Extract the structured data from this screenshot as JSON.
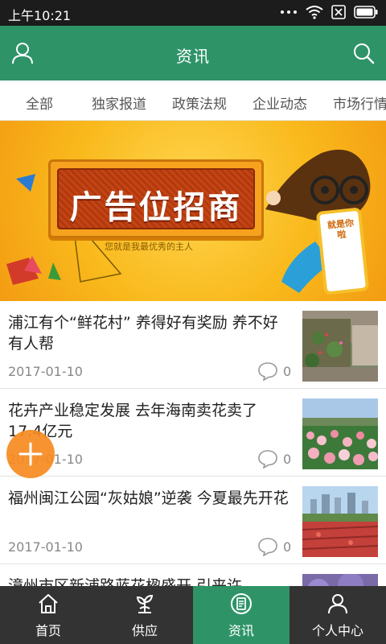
{
  "status_bar": {
    "time": "上午10:21"
  },
  "header": {
    "title": "资讯"
  },
  "tabs": [
    {
      "label": "全部"
    },
    {
      "label": "独家报道"
    },
    {
      "label": "政策法规"
    },
    {
      "label": "企业动态"
    },
    {
      "label": "市场行情"
    }
  ],
  "banner": {
    "headline": "广告位招商",
    "subtext": "您就是我最优秀的主人",
    "phone_text": "就是你啦"
  },
  "news": [
    {
      "title": "浦江有个“鲜花村” 养得好有奖励 养不好有人帮",
      "date": "2017-01-10",
      "comments": "0"
    },
    {
      "title": "花卉产业稳定发展 去年海南卖花卖了17.4亿元",
      "date": "2017-01-10",
      "comments": "0"
    },
    {
      "title": "福州闽江公园“灰姑娘”逆袭 今夏最先开花",
      "date": "2017-01-10",
      "comments": "0"
    },
    {
      "title": "漳州市区新浦路蓝花楹盛开 引来许",
      "date": "",
      "comments": ""
    }
  ],
  "bottom_nav": [
    {
      "label": "首页",
      "icon": "home-icon"
    },
    {
      "label": "供应",
      "icon": "supply-icon"
    },
    {
      "label": "资讯",
      "icon": "news-icon",
      "active": true
    },
    {
      "label": "个人中心",
      "icon": "person-icon"
    }
  ],
  "colors": {
    "primary": "#2e9468",
    "nav_bg": "#333333",
    "fab": "#f68b1f"
  }
}
